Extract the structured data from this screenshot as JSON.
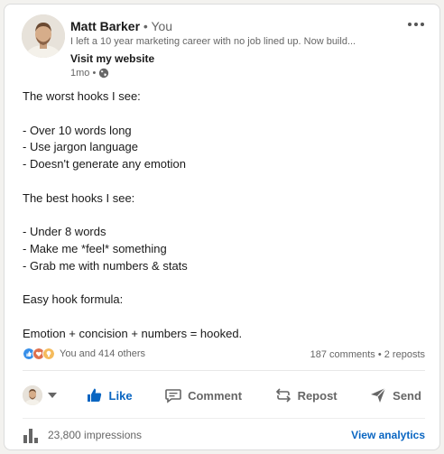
{
  "author": {
    "name": "Matt Barker",
    "degree": " • You",
    "headline": "I left a 10 year marketing career with no job lined up. Now build...",
    "website_label": "Visit my website",
    "time": "1mo •",
    "visibility_icon": "globe-icon"
  },
  "post": {
    "lines": [
      "The worst hooks I see:",
      "",
      "- Over 10 words long",
      "- Use jargon language",
      "- Doesn't generate any emotion",
      "",
      "The best hooks I see:",
      "",
      "- Under 8 words",
      "- Make me *feel* something",
      "- Grab me with numbers & stats",
      "",
      "Easy hook formula:",
      "",
      "Emotion + concision + numbers = hooked."
    ]
  },
  "social": {
    "reaction_icons": [
      "like-reaction-icon",
      "love-reaction-icon",
      "insightful-reaction-icon"
    ],
    "reactions_text": "You and 414 others",
    "counts_text": "187 comments • 2 reposts"
  },
  "actions": {
    "like": "Like",
    "comment": "Comment",
    "repost": "Repost",
    "send": "Send"
  },
  "footer": {
    "impressions": "23,800 impressions",
    "analytics": "View analytics"
  },
  "colors": {
    "accent": "#0a66c2",
    "muted_text": "#666666",
    "love": "#df704d",
    "insightful": "#f5bb5c"
  }
}
